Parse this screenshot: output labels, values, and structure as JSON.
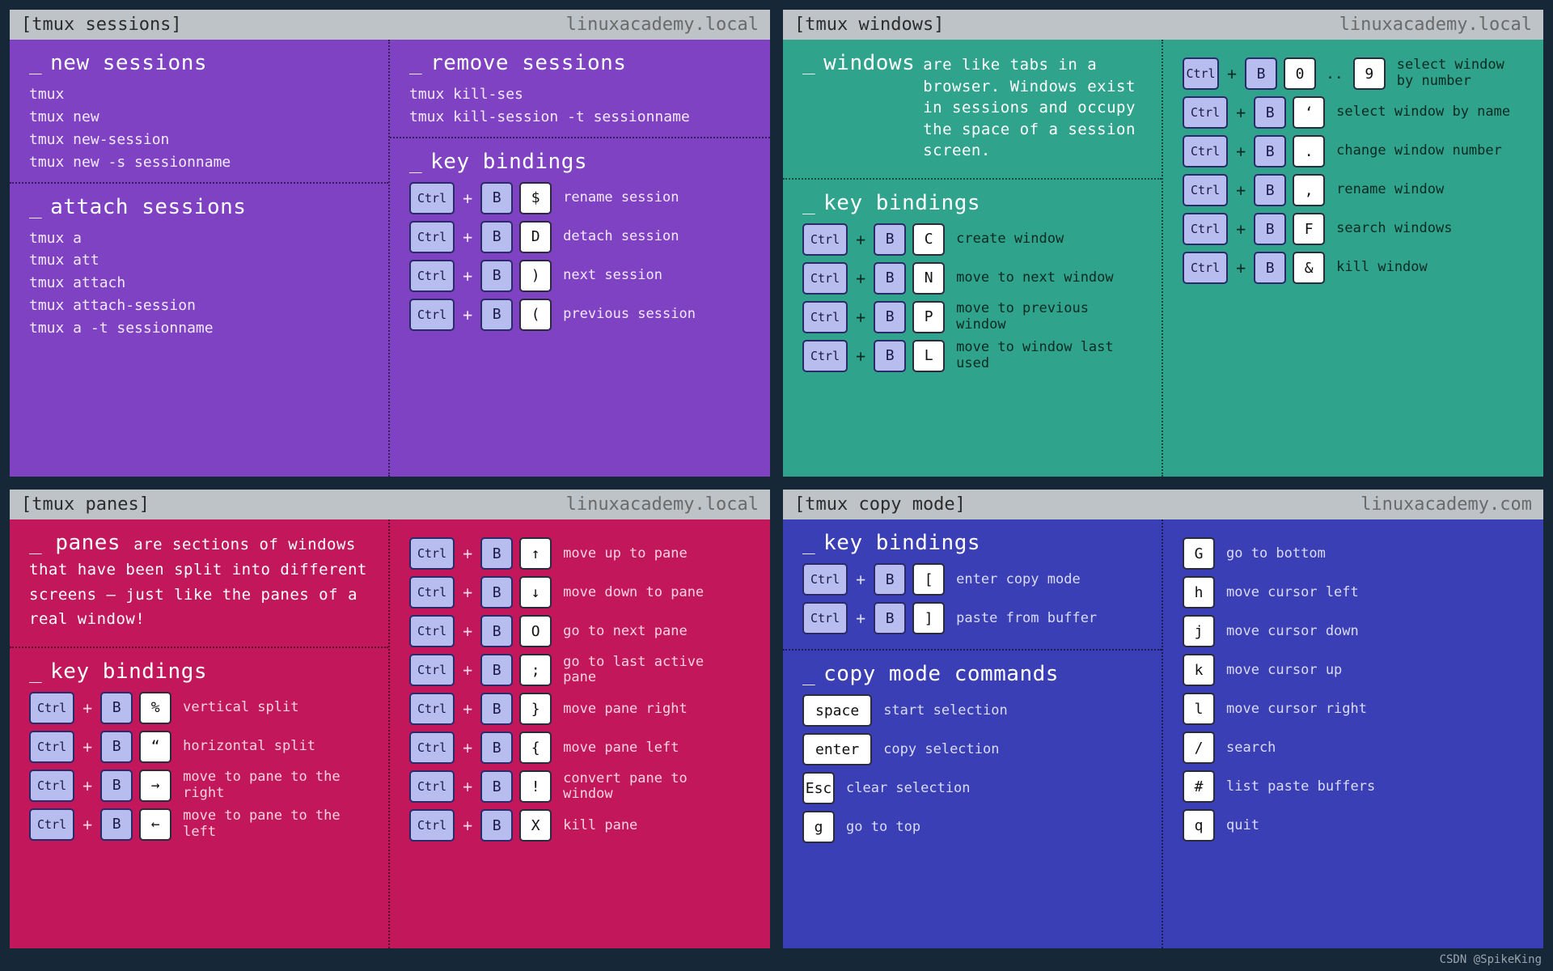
{
  "footer": "CSDN @SpikeKing",
  "hosts": {
    "local": "linuxacademy.local",
    "com": "linuxacademy.com"
  },
  "cards": {
    "sessions": {
      "title": "[tmux sessions]",
      "new": {
        "head": "new sessions",
        "lines": [
          "tmux",
          "tmux new",
          "tmux new-session",
          "tmux new -s sessionname"
        ]
      },
      "attach": {
        "head": "attach sessions",
        "lines": [
          "tmux a",
          "tmux att",
          "tmux attach",
          "tmux attach-session",
          "tmux a -t sessionname"
        ]
      },
      "remove": {
        "head": "remove sessions",
        "lines": [
          "tmux kill-ses",
          "tmux kill-session -t sessionname"
        ]
      },
      "kb": {
        "head": "key bindings",
        "rows": [
          {
            "k": "$",
            "d": "rename session"
          },
          {
            "k": "D",
            "d": "detach session"
          },
          {
            "k": ")",
            "d": "next session"
          },
          {
            "k": "(",
            "d": "previous session"
          }
        ]
      }
    },
    "windows": {
      "title": "[tmux windows]",
      "intro": {
        "head": "windows",
        "desc": "are like tabs in a browser. Windows exist in sessions and occupy the space of a session screen."
      },
      "kbL": {
        "head": "key bindings",
        "rows": [
          {
            "k": "C",
            "d": "create window"
          },
          {
            "k": "N",
            "d": "move to next window"
          },
          {
            "k": "P",
            "d": "move to previous window"
          },
          {
            "k": "L",
            "d": "move to window last used"
          }
        ]
      },
      "kbR": [
        {
          "k": "0",
          "k2": "9",
          "range": true,
          "d": "select window by number"
        },
        {
          "k": "‘",
          "d": "select window by name"
        },
        {
          "k": ".",
          "d": "change window number"
        },
        {
          "k": ",",
          "d": "rename window"
        },
        {
          "k": "F",
          "d": "search windows"
        },
        {
          "k": "&",
          "d": "kill window"
        }
      ]
    },
    "panes": {
      "title": "[tmux panes]",
      "intro": {
        "head": "panes",
        "desc": "are sections of windows that have been split into different screens — just like the panes of a real window!"
      },
      "kbL": {
        "head": "key bindings",
        "rows": [
          {
            "k": "%",
            "d": "vertical split"
          },
          {
            "k": "“",
            "d": "horizontal split"
          },
          {
            "k": "→",
            "d": "move to pane to the right"
          },
          {
            "k": "←",
            "d": "move to pane to the left"
          }
        ]
      },
      "kbR": [
        {
          "k": "↑",
          "d": "move up to pane"
        },
        {
          "k": "↓",
          "d": "move down to pane"
        },
        {
          "k": "O",
          "d": "go to next pane"
        },
        {
          "k": ";",
          "d": "go to last active pane"
        },
        {
          "k": "}",
          "d": "move pane right"
        },
        {
          "k": "{",
          "d": "move pane left"
        },
        {
          "k": "!",
          "d": "convert pane to window"
        },
        {
          "k": "X",
          "d": "kill pane"
        }
      ]
    },
    "copy": {
      "title": "[tmux copy mode]",
      "kbL": {
        "head": "key bindings",
        "rows": [
          {
            "k": "[",
            "d": "enter copy mode"
          },
          {
            "k": "]",
            "d": "paste from buffer"
          }
        ]
      },
      "cmds": {
        "head": "copy mode commands",
        "rows": [
          {
            "k": "space",
            "wide": true,
            "d": "start selection"
          },
          {
            "k": "enter",
            "wide": true,
            "d": "copy selection"
          },
          {
            "k": "Esc",
            "d": "clear selection"
          },
          {
            "k": "g",
            "d": "go to top"
          }
        ]
      },
      "kbR": [
        {
          "k": "G",
          "d": "go to bottom"
        },
        {
          "k": "h",
          "d": "move cursor left"
        },
        {
          "k": "j",
          "d": "move cursor down"
        },
        {
          "k": "k",
          "d": "move cursor up"
        },
        {
          "k": "l",
          "d": "move cursor right"
        },
        {
          "k": "/",
          "d": "search"
        },
        {
          "k": "#",
          "d": "list paste buffers"
        },
        {
          "k": "q",
          "d": "quit"
        }
      ]
    }
  }
}
